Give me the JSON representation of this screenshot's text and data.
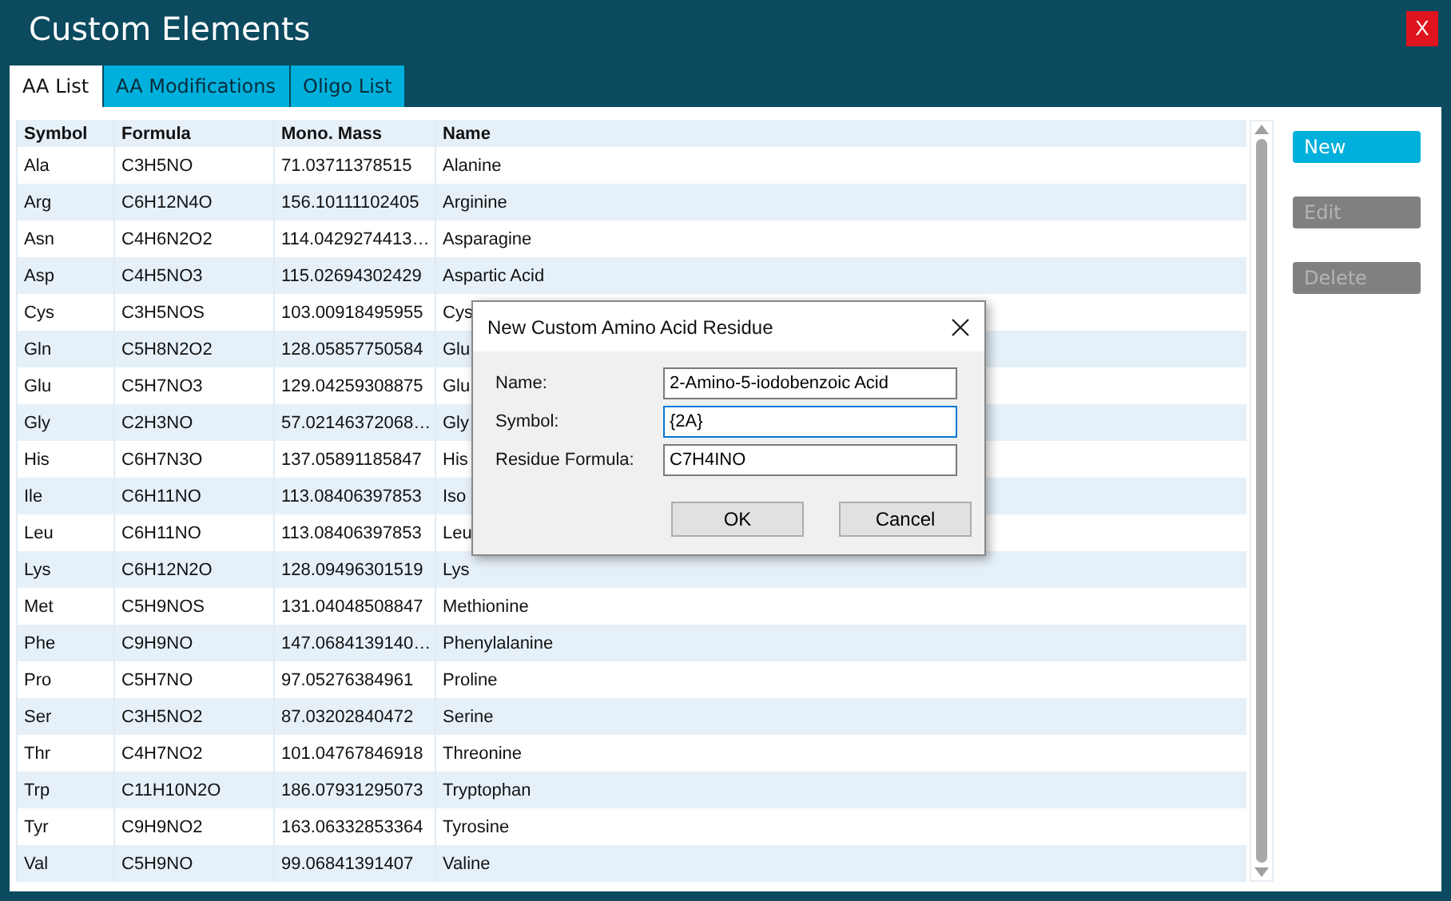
{
  "window": {
    "title": "Custom Elements",
    "close": "X"
  },
  "tabs": [
    {
      "label": "AA List",
      "selected": true
    },
    {
      "label": "AA Modifications",
      "selected": false
    },
    {
      "label": "Oligo List",
      "selected": false
    }
  ],
  "table": {
    "columns": [
      "Symbol",
      "Formula",
      "Mono. Mass",
      "Name"
    ],
    "rows": [
      [
        "Ala",
        "C3H5NO",
        "71.03711378515",
        "Alanine"
      ],
      [
        "Arg",
        "C6H12N4O",
        "156.10111102405",
        "Arginine"
      ],
      [
        "Asn",
        "C4H6N2O2",
        "114.0429274413…",
        "Asparagine"
      ],
      [
        "Asp",
        "C4H5NO3",
        "115.02694302429",
        "Aspartic Acid"
      ],
      [
        "Cys",
        "C3H5NOS",
        "103.00918495955",
        "Cys"
      ],
      [
        "Gln",
        "C5H8N2O2",
        "128.05857750584",
        "Glu"
      ],
      [
        "Glu",
        "C5H7NO3",
        "129.04259308875",
        "Glu"
      ],
      [
        "Gly",
        "C2H3NO",
        "57.02146372068…",
        "Gly"
      ],
      [
        "His",
        "C6H7N3O",
        "137.05891185847",
        "His"
      ],
      [
        "Ile",
        "C6H11NO",
        "113.08406397853",
        "Iso"
      ],
      [
        "Leu",
        "C6H11NO",
        "113.08406397853",
        "Leu"
      ],
      [
        "Lys",
        "C6H12N2O",
        "128.09496301519",
        "Lys"
      ],
      [
        "Met",
        "C5H9NOS",
        "131.04048508847",
        "Methionine"
      ],
      [
        "Phe",
        "C9H9NO",
        "147.0684139140…",
        "Phenylalanine"
      ],
      [
        "Pro",
        "C5H7NO",
        "97.05276384961",
        "Proline"
      ],
      [
        "Ser",
        "C3H5NO2",
        "87.03202840472",
        "Serine"
      ],
      [
        "Thr",
        "C4H7NO2",
        "101.04767846918",
        "Threonine"
      ],
      [
        "Trp",
        "C11H10N2O",
        "186.07931295073",
        "Tryptophan"
      ],
      [
        "Tyr",
        "C9H9NO2",
        "163.06332853364",
        "Tyrosine"
      ],
      [
        "Val",
        "C5H9NO",
        "99.06841391407",
        "Valine"
      ]
    ]
  },
  "side_buttons": [
    {
      "label": "New",
      "disabled": false
    },
    {
      "label": "Edit",
      "disabled": true
    },
    {
      "label": "Delete",
      "disabled": true
    }
  ],
  "dialog": {
    "title": "New Custom Amino Acid Residue",
    "fields": [
      {
        "label": "Name:",
        "value": "2-Amino-5-iodobenzoic Acid",
        "focused": false
      },
      {
        "label": "Symbol:",
        "value": "{2A}",
        "focused": true
      },
      {
        "label": "Residue Formula:",
        "value": "C7H4INO",
        "focused": false
      }
    ],
    "buttons": [
      "OK",
      "Cancel"
    ]
  }
}
